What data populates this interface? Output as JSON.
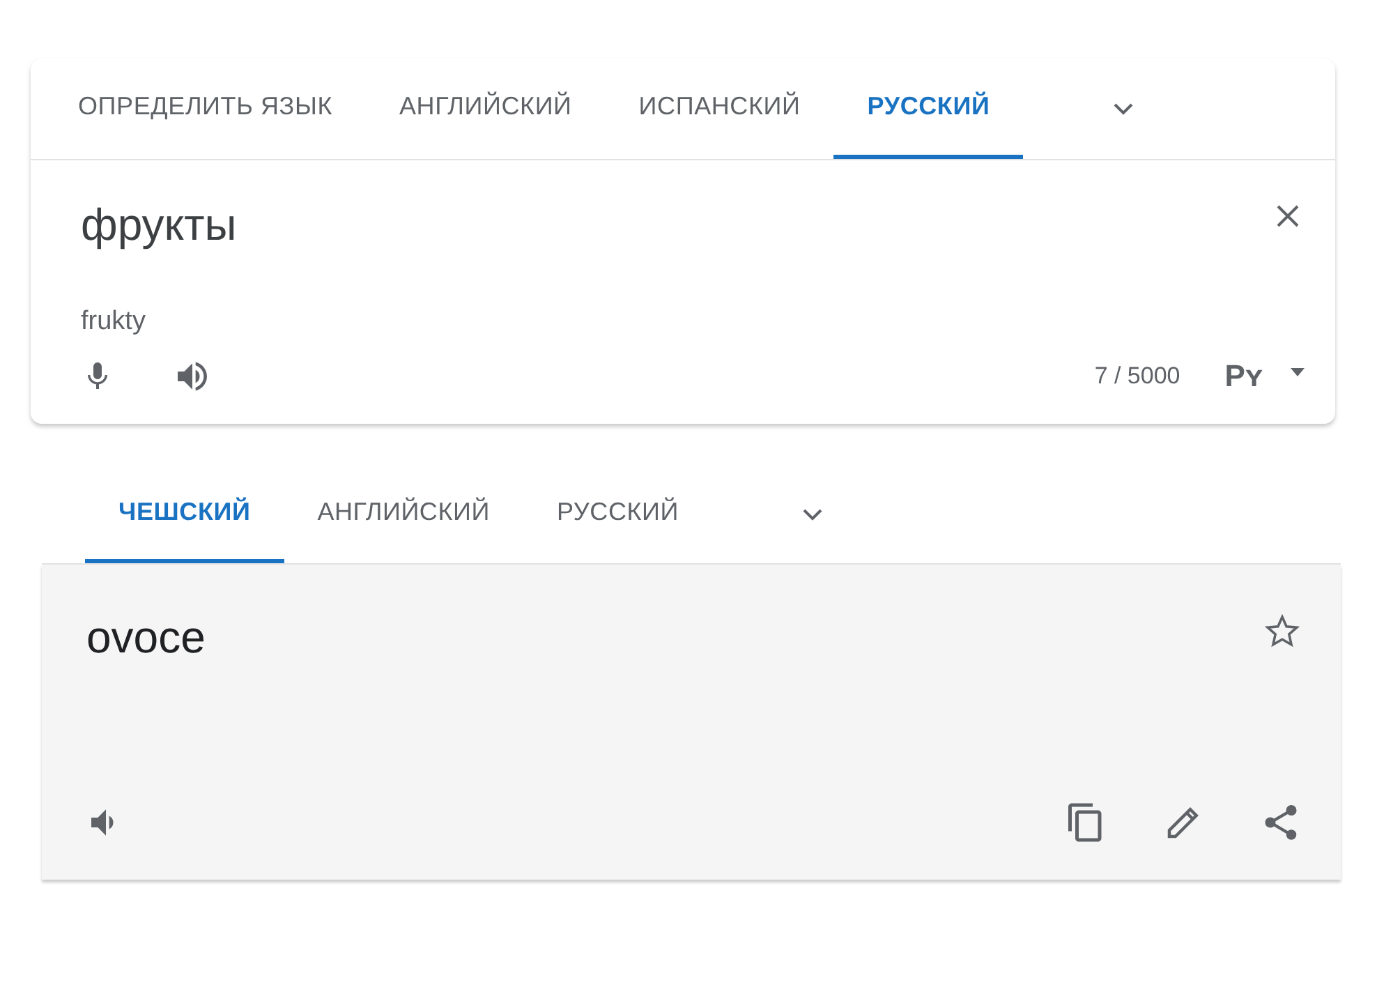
{
  "source": {
    "tabs": [
      {
        "label": "ОПРЕДЕЛИТЬ ЯЗЫК",
        "selected": false
      },
      {
        "label": "АНГЛИЙСКИЙ",
        "selected": false
      },
      {
        "label": "ИСПАНСКИЙ",
        "selected": false
      },
      {
        "label": "РУССКИЙ",
        "selected": true
      }
    ],
    "text": "фрукты",
    "transliteration": "frukty",
    "char_count": "7 / 5000",
    "input_tool": "Pʏ"
  },
  "target": {
    "tabs": [
      {
        "label": "ЧЕШСКИЙ",
        "selected": true
      },
      {
        "label": "АНГЛИЙСКИЙ",
        "selected": false
      },
      {
        "label": "РУССКИЙ",
        "selected": false
      }
    ],
    "translation": "ovoce"
  }
}
